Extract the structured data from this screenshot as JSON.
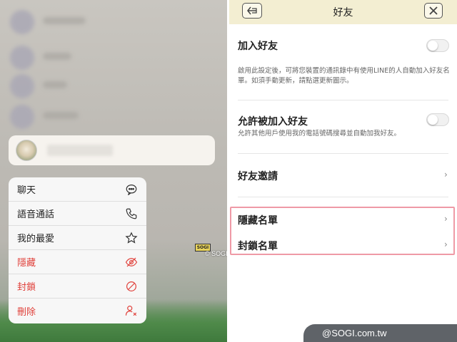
{
  "context_menu": {
    "items": [
      {
        "label": "聊天",
        "icon": "chat-bubble-icon",
        "danger": false
      },
      {
        "label": "語音通話",
        "icon": "phone-icon",
        "danger": false
      },
      {
        "label": "我的最愛",
        "icon": "star-icon",
        "danger": false
      },
      {
        "label": "隱藏",
        "icon": "eye-off-icon",
        "danger": true
      },
      {
        "label": "封鎖",
        "icon": "block-icon",
        "danger": true
      },
      {
        "label": "刪除",
        "icon": "remove-user-icon",
        "danger": true
      }
    ]
  },
  "settings": {
    "title": "好友",
    "add_friends": {
      "label": "加入好友",
      "enabled": false,
      "description": "啟用此設定後，可將您裝置的通訊錄中有使用LINE的人自動加入好友名單。如須手動更新，請點選更新圖示。"
    },
    "allow_others": {
      "label": "允許被加入好友",
      "enabled": false,
      "description": "允許其他用戶使用我的電話號碼搜尋並自動加我好友。"
    },
    "invite": {
      "label": "好友邀請"
    },
    "hidden_list": {
      "label": "隱藏名單"
    },
    "blocked_list": {
      "label": "封鎖名單"
    }
  },
  "watermark": {
    "badge": "SOGI",
    "small": "© SOGI.com.tw",
    "main": "@SOGI.com.tw"
  },
  "colors": {
    "nav_bg": "#f3eed2",
    "danger": "#e0403a",
    "highlight": "#ef9aa6"
  }
}
